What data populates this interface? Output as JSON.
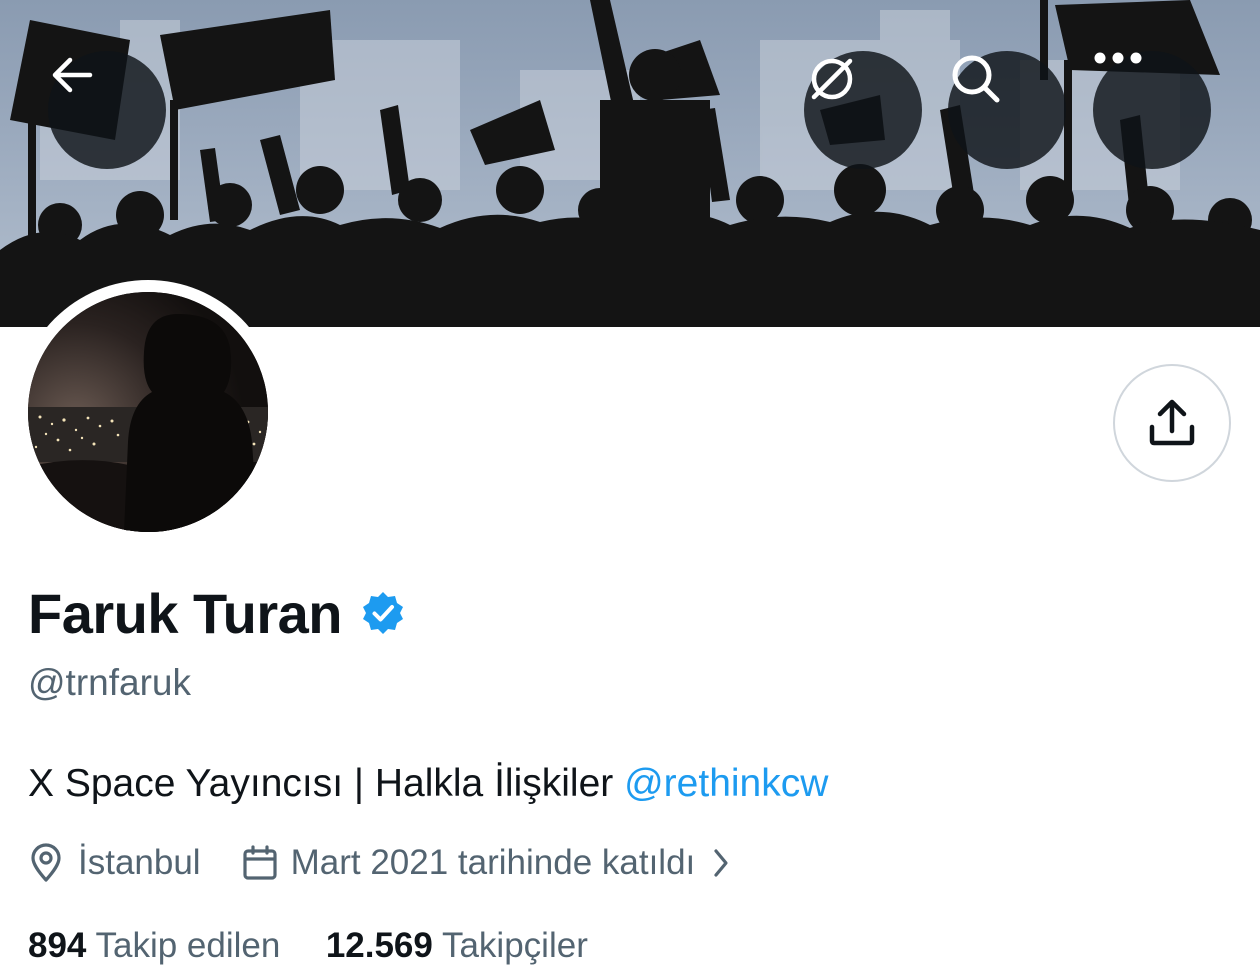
{
  "profile": {
    "name": "Faruk Turan",
    "handle": "@trnfaruk",
    "bio_text": "X Space Yayıncısı | Halkla İlişkiler ",
    "bio_mention": "@rethinkcw",
    "location": "İstanbul",
    "joined": "Mart 2021 tarihinde katıldı",
    "following_count": "894",
    "following_label": "Takip edilen",
    "followers_count": "12.569",
    "followers_label": "Takipçiler",
    "verified": true
  },
  "icons": {
    "back": "arrow-left-icon",
    "grok": "grok-icon",
    "search": "search-icon",
    "more": "more-icon",
    "share": "share-icon",
    "verified": "verified-badge-icon",
    "location": "location-pin-icon",
    "calendar": "calendar-icon",
    "chevron": "chevron-right-icon"
  },
  "colors": {
    "accent": "#1d9bf0",
    "secondary_text": "#536471",
    "primary_text": "#0f1419"
  }
}
